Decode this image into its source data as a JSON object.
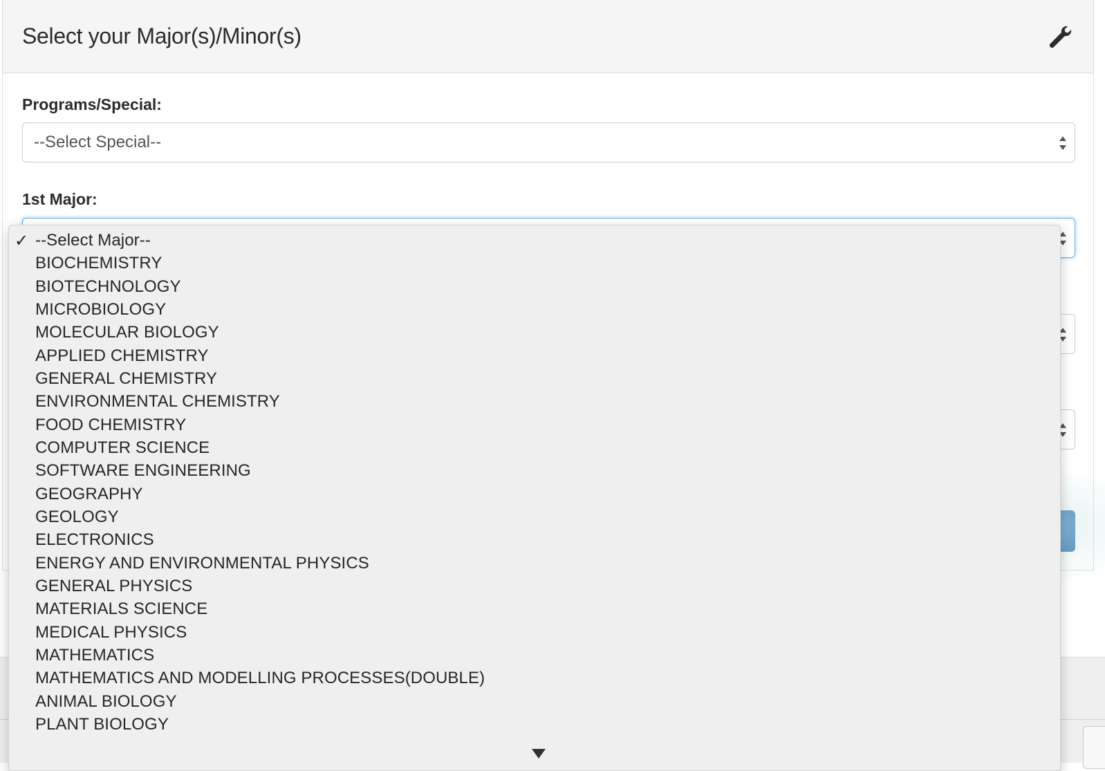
{
  "panel": {
    "title": "Select your Major(s)/Minor(s)",
    "settings_icon": "wrench-icon"
  },
  "fields": {
    "special_label": "Programs/Special:",
    "special_value": "--Select Special--",
    "major1_label": "1st Major:"
  },
  "dropdown": {
    "options": [
      "--Select Major--",
      "BIOCHEMISTRY",
      "BIOTECHNOLOGY",
      "MICROBIOLOGY",
      "MOLECULAR BIOLOGY",
      "APPLIED CHEMISTRY",
      "GENERAL CHEMISTRY",
      "ENVIRONMENTAL CHEMISTRY",
      "FOOD CHEMISTRY",
      "COMPUTER SCIENCE",
      "SOFTWARE ENGINEERING",
      "GEOGRAPHY",
      "GEOLOGY",
      "ELECTRONICS",
      "ENERGY AND ENVIRONMENTAL PHYSICS",
      "GENERAL PHYSICS",
      "MATERIALS SCIENCE",
      "MEDICAL PHYSICS",
      "MATHEMATICS",
      "MATHEMATICS AND MODELLING PROCESSES(DOUBLE)",
      "ANIMAL BIOLOGY",
      "PLANT BIOLOGY"
    ],
    "selected_index": 0,
    "check_glyph": "✓"
  },
  "colors": {
    "accent": "#337ab7",
    "focus": "#66afe9"
  }
}
